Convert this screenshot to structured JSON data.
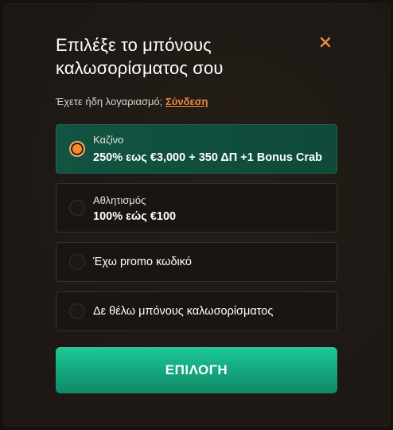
{
  "modal": {
    "title": "Επιλέξε το μπόνους καλωσορίσματος σου",
    "close_icon": "close-icon",
    "accent_color": "#f08a3c",
    "success_color": "#14a47c"
  },
  "login": {
    "prompt": "Έχετε ήδη λογαριασμό;",
    "link_label": "Σύνδεση"
  },
  "options": [
    {
      "title": "Καζίνο",
      "description": "250% εως €3,000 + 350 ΔΠ +1 Bonus Crab",
      "selected": true
    },
    {
      "title": "Αθλητισμός",
      "description": "100% εώς €100",
      "selected": false
    },
    {
      "label": "Έχω promo κωδικό",
      "selected": false
    },
    {
      "label": "Δε θέλω μπόνους καλωσορίσματος",
      "selected": false
    }
  ],
  "cta": {
    "label": "ΕΠΙΛΟΓΗ"
  }
}
